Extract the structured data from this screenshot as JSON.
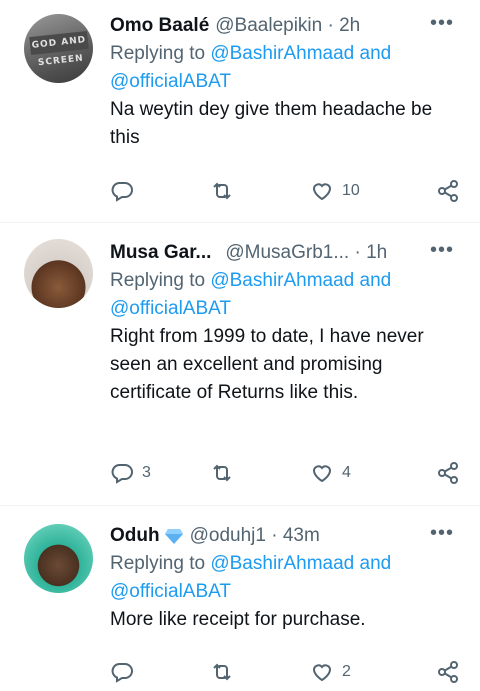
{
  "tweets": [
    {
      "name": "Omo Baalé",
      "handle": "@Baalepikin · 2h",
      "reply_prefix": "Replying to ",
      "reply_user1": "@BashirAhmaad",
      "reply_and": " and",
      "reply_user2": "@officialABAT",
      "text": "Na weytin dey give them headache be this",
      "replies": "",
      "likes": "10",
      "avatar_text": "GOD AND SCREEN"
    },
    {
      "name": "Musa Gar...",
      "handle": "@MusaGrb1... · 1h",
      "reply_prefix": "Replying to ",
      "reply_user1": "@BashirAhmaad",
      "reply_and": " and",
      "reply_user2": "@officialABAT",
      "text": "Right from 1999 to date, I have never seen an excellent and promising certificate of Returns like this.",
      "replies": "3",
      "likes": "4"
    },
    {
      "name": "Oduh",
      "handle": "@oduhj1 · 43m",
      "reply_prefix": "Replying to ",
      "reply_user1": "@BashirAhmaad",
      "reply_and": " and",
      "reply_user2": "@officialABAT",
      "text": "More like receipt for purchase.",
      "replies": "",
      "likes": "2"
    }
  ],
  "more_label": "•••",
  "colors": {
    "link": "#1d9bf0",
    "muted": "#536471",
    "text": "#0f1419",
    "verified_gem": "#5ab0f0"
  }
}
